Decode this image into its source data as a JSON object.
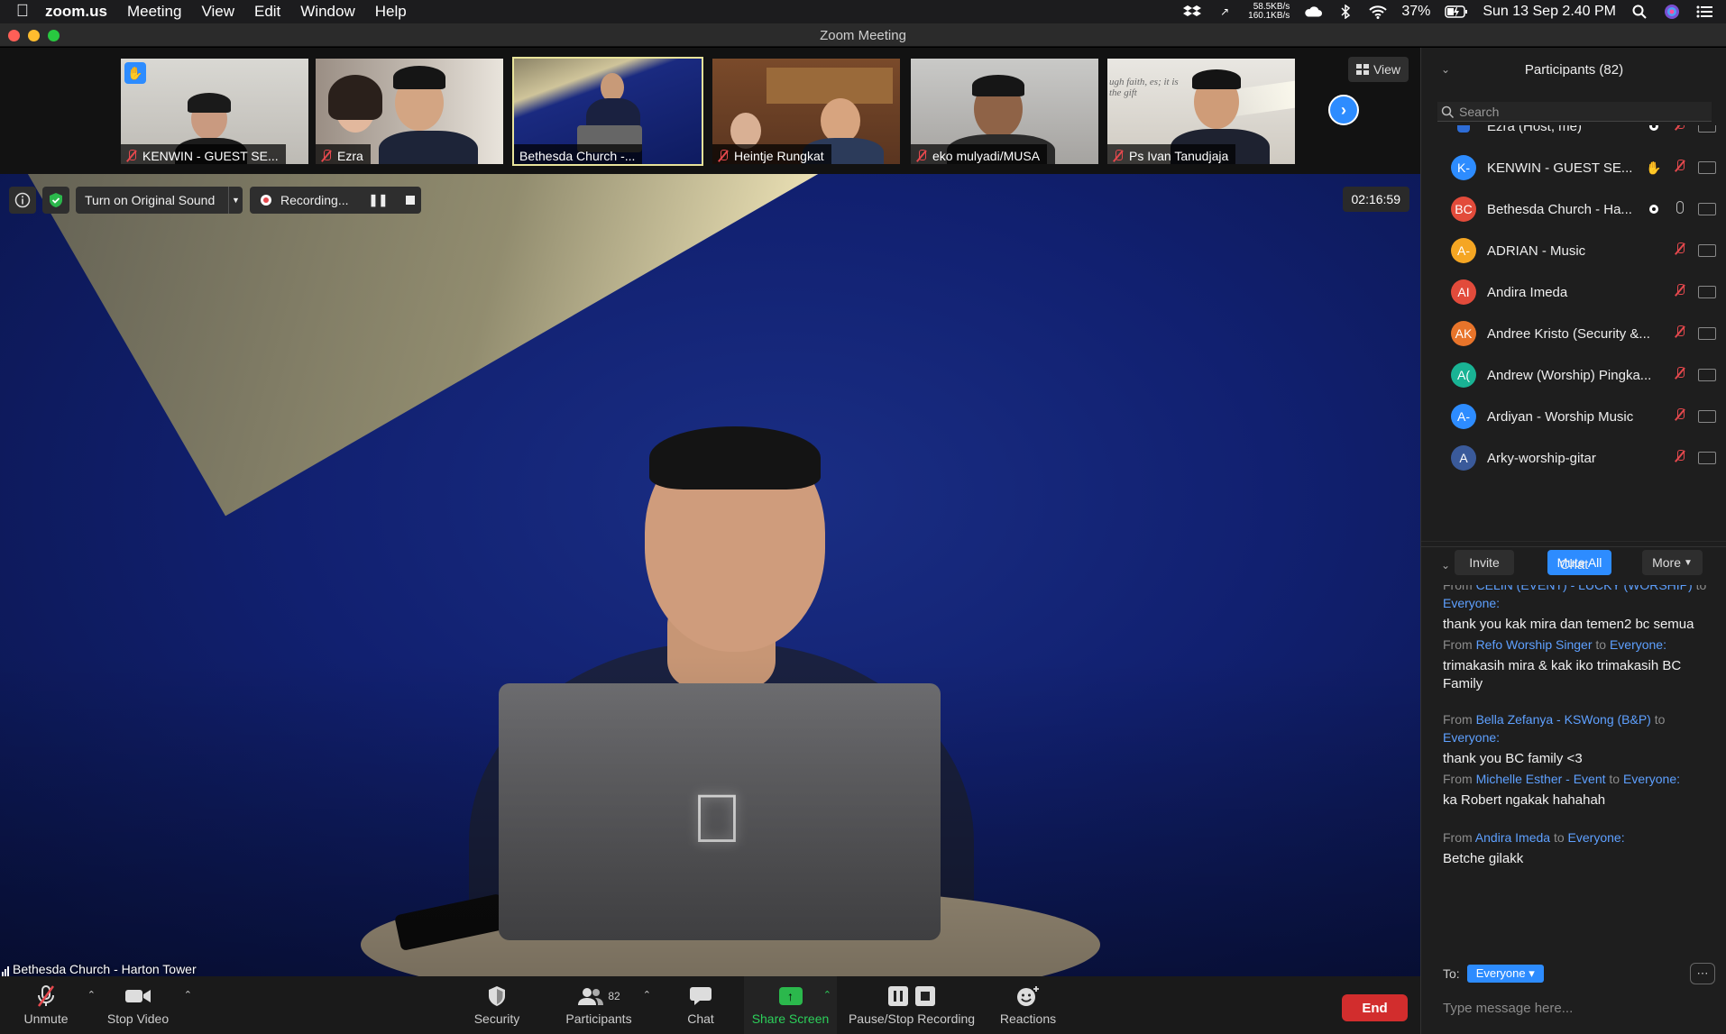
{
  "menubar": {
    "items": [
      "zoom.us",
      "Meeting",
      "View",
      "Edit",
      "Window",
      "Help"
    ],
    "net_up": "58.5KB/s",
    "net_down": "160.1KB/s",
    "battery": "37%",
    "datetime": "Sun 13 Sep  2.40 PM"
  },
  "window": {
    "title": "Zoom Meeting"
  },
  "thumbnails": [
    {
      "label": "KENWIN - GUEST SE...",
      "muted": true,
      "hand": true
    },
    {
      "label": "Ezra",
      "muted": true
    },
    {
      "label": "Bethesda Church -...",
      "muted": false,
      "active": true
    },
    {
      "label": "Heintje Rungkat",
      "muted": true
    },
    {
      "label": "eko mulyadi/MUSA",
      "muted": true
    },
    {
      "label": "Ps Ivan Tanudjaja",
      "muted": true,
      "backdrop_text": "ugh faith, es; it is the gift"
    }
  ],
  "view_button": "View",
  "video": {
    "original_sound_label": "Turn on Original Sound",
    "recording_label": "Recording...",
    "timer": "02:16:59",
    "speaker_name": "Bethesda Church - Harton Tower"
  },
  "toolbar": {
    "unmute": "Unmute",
    "stop_video": "Stop Video",
    "security": "Security",
    "participants": "Participants",
    "participants_count": "82",
    "chat": "Chat",
    "share_screen": "Share Screen",
    "pause_stop_recording": "Pause/Stop Recording",
    "reactions": "Reactions",
    "end": "End"
  },
  "participants_panel": {
    "title": "Participants (82)",
    "search_placeholder": "Search",
    "rows": [
      {
        "initials": "",
        "name": "Ezra (Host, me)",
        "color": "#2d6cd6",
        "status": "rec",
        "muted": true
      },
      {
        "initials": "K-",
        "name": "KENWIN - GUEST SE...",
        "color": "#2d8cff",
        "status": "hand",
        "muted": true
      },
      {
        "initials": "BC",
        "name": "Bethesda Church - Ha...",
        "color": "#e24b3b",
        "status": "rec",
        "muted": false
      },
      {
        "initials": "A-",
        "name": "ADRIAN - Music",
        "color": "#f5a623",
        "status": "",
        "muted": true
      },
      {
        "initials": "AI",
        "name": "Andira Imeda",
        "color": "#e24b3b",
        "status": "",
        "muted": true
      },
      {
        "initials": "AK",
        "name": "Andree Kristo (Security &...",
        "color": "#e8742a",
        "status": "",
        "muted": true
      },
      {
        "initials": "A(",
        "name": "Andrew (Worship) Pingka...",
        "color": "#19b394",
        "status": "",
        "muted": true
      },
      {
        "initials": "A-",
        "name": "Ardiyan - Worship Music",
        "color": "#2d8cff",
        "status": "",
        "muted": true
      },
      {
        "initials": "A",
        "name": "Arky-worship-gitar",
        "color": "#3a5a9a",
        "status": "",
        "muted": true
      }
    ],
    "invite": "Invite",
    "mute_all": "Mute All",
    "more": "More"
  },
  "chat_panel": {
    "title": "Chat",
    "messages": [
      {
        "from": "From",
        "sender": "CELIN (EVENT) - LUCKY (WORSHIP)",
        "to": "to",
        "recipient": "Everyone:",
        "text": "thank you kak mira dan temen2 bc semua"
      },
      {
        "from": "From",
        "sender": "Refo Worship Singer",
        "to": "to",
        "recipient": "Everyone:",
        "text": "trimakasih mira  & kak iko trimakasih BC Family"
      },
      {
        "from": "From",
        "sender": "Bella Zefanya - KSWong (B&P)",
        "to": "to",
        "recipient": "Everyone:",
        "text": "thank you BC family <3"
      },
      {
        "from": "From",
        "sender": "Michelle Esther - Event",
        "to": "to",
        "recipient": "Everyone:",
        "text": "ka Robert ngakak hahahah"
      },
      {
        "from": "From",
        "sender": "Andira Imeda",
        "to": "to",
        "recipient": "Everyone:",
        "text": "Betche gilakk"
      }
    ],
    "to_label": "To:",
    "to_value": "Everyone",
    "input_placeholder": "Type message here..."
  }
}
